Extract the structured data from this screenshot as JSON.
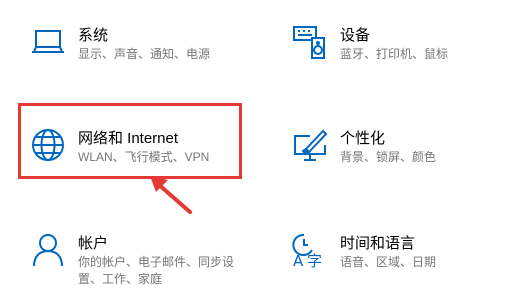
{
  "accent": "#0067c0",
  "highlight_color": "#e53935",
  "tiles": {
    "system": {
      "icon": "laptop-icon",
      "title": "系统",
      "desc": "显示、声音、通知、电源"
    },
    "devices": {
      "icon": "keyboard-speaker-icon",
      "title": "设备",
      "desc": "蓝牙、打印机、鼠标"
    },
    "network": {
      "icon": "globe-icon",
      "title": "网络和 Internet",
      "desc": "WLAN、飞行模式、VPN"
    },
    "personal": {
      "icon": "paint-monitor-icon",
      "title": "个性化",
      "desc": "背景、锁屏、颜色"
    },
    "accounts": {
      "icon": "person-icon",
      "title": "帐户",
      "desc": "你的帐户、电子邮件、同步设置、工作、家庭"
    },
    "time": {
      "icon": "time-language-icon",
      "title": "时间和语言",
      "desc": "语音、区域、日期"
    }
  }
}
